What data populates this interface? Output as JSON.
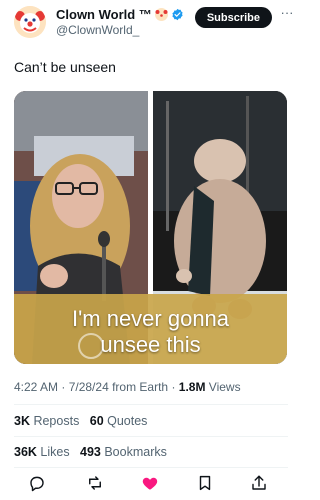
{
  "account": {
    "display_name": "Clown World ™",
    "handle": "@ClownWorld_",
    "subscribe_label": "Subscribe",
    "more_label": "···"
  },
  "post": {
    "text": "Can’t be unseen",
    "image_caption_line1": "I'm never gonna",
    "image_caption_line2": "unsee this"
  },
  "meta": {
    "time": "4:22 AM",
    "sep1": " · ",
    "date": "7/28/24",
    "from": " from Earth",
    "sep2": " · ",
    "views_count": "1.8M",
    "views_label": " Views"
  },
  "stats": {
    "reposts_count": "3K",
    "reposts_label": " Reposts",
    "quotes_count": "60",
    "quotes_label": " Quotes",
    "likes_count": "36K",
    "likes_label": " Likes",
    "bookmarks_count": "493",
    "bookmarks_label": " Bookmarks"
  },
  "actions": [
    {
      "icon": "reply-icon"
    },
    {
      "icon": "repost-icon"
    },
    {
      "icon": "like-icon",
      "color": "#f91880"
    },
    {
      "icon": "bookmark-icon"
    },
    {
      "icon": "share-icon"
    }
  ],
  "colors": {
    "text_primary": "#0f1419",
    "text_secondary": "#536471",
    "like": "#f91880",
    "verified": "#1d9bf0"
  }
}
